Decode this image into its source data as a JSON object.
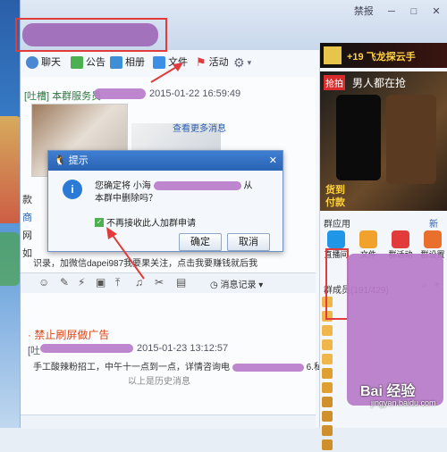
{
  "titlebar": {
    "controls": [
      "禁报",
      "─",
      "□",
      "✕"
    ]
  },
  "toolbar": {
    "items": [
      {
        "label": "聊天",
        "icon": "chat-icon",
        "color": "#4a88d4"
      },
      {
        "label": "公告",
        "icon": "announce-icon",
        "color": "#4caf50"
      },
      {
        "label": "相册",
        "icon": "album-icon",
        "color": "#3f8fd6"
      },
      {
        "label": "文件",
        "icon": "folder-icon",
        "color": "#3d8fe6"
      },
      {
        "label": "活动",
        "icon": "flag-icon",
        "color": "#e23b3b"
      }
    ]
  },
  "chat": {
    "msg1_header": "[吐槽] 本群服务员",
    "msg1_time": "2015-01-22 16:59:49",
    "more_link": "查看更多消息",
    "side_fragments": [
      "款",
      "商",
      "网",
      "如"
    ],
    "line_a": "识录，加微信dapei987我要果关注，点击我要赚钱就后我",
    "notice_title": "· 禁止刷屏做广告",
    "msg2_prefix": "[吐",
    "msg2_time": "2015-01-23 13:12:57",
    "msg2_body": "手工酸辣粉招工，中午十一点到一点，详情咨询电",
    "msg2_tail": "6.私聊不回",
    "history": "以上是历史消息"
  },
  "dialog": {
    "title": "提示",
    "message_line1_prefix": "您确定将 小海",
    "message_line1_suffix": "从",
    "message_line2": "本群中删除吗？",
    "checkbox_label": "不再接收此人加群申请",
    "ok_label": "确定",
    "cancel_label": "取消"
  },
  "input_bar": {
    "history_label": "消息记录"
  },
  "right_panel": {
    "top_ad": "+19 飞龙探云手",
    "ad_title": "男人都在抢",
    "ad_badge": "抢拍",
    "ad_bottom_1": "货到",
    "ad_bottom_2": "付款",
    "apps_header": "群应用",
    "apps_new": "新",
    "apps": [
      {
        "label": "直播间",
        "color": "#1f96e6"
      },
      {
        "label": "文件",
        "color": "#f0a22d"
      },
      {
        "label": "群活动",
        "color": "#e23b3b"
      },
      {
        "label": "群设置",
        "color": "#e86f2c"
      }
    ],
    "members_header": "群成员(191/429)"
  },
  "watermark": {
    "text": "Bai 经验",
    "url": "jingyan.baidu.com"
  }
}
